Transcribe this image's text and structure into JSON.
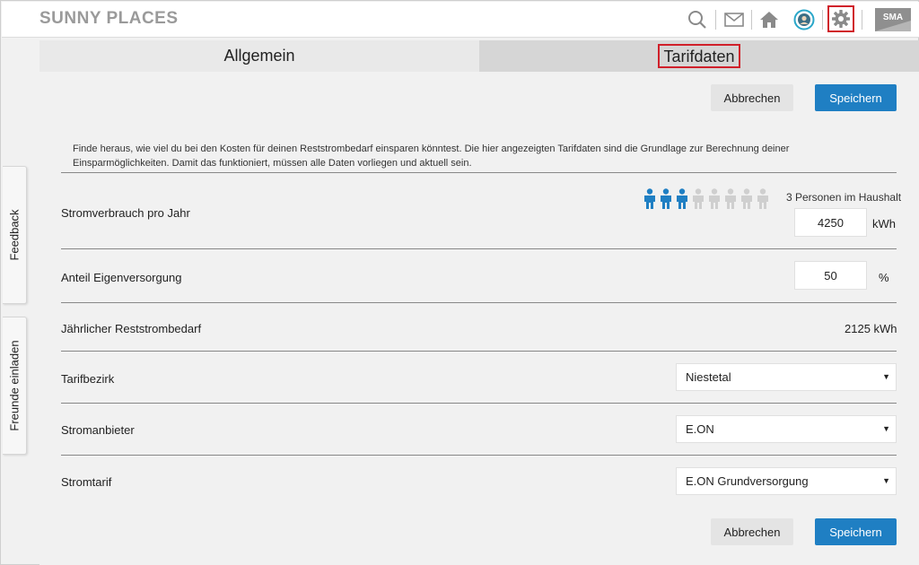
{
  "app": {
    "title": "SUNNY PLACES",
    "brand_logo": "SMA"
  },
  "header_icons": [
    "search-icon",
    "mail-icon",
    "home-icon",
    "profile-icon",
    "gear-icon"
  ],
  "side_tabs": {
    "feedback": "Feedback",
    "invite": "Freunde einladen"
  },
  "tabs": [
    {
      "label": "Allgemein",
      "active": false
    },
    {
      "label": "Tarifdaten",
      "active": true
    }
  ],
  "actions": {
    "cancel": "Abbrechen",
    "save": "Speichern"
  },
  "intro": "Finde heraus, wie viel du bei den Kosten für deinen Reststrombedarf einsparen könntest. Die hier angezeigten Tarifdaten sind die Grundlage zur Berechnung deiner Einsparmöglichkeiten. Damit das funktioniert, müssen alle Daten vorliegen und aktuell sein.",
  "consumption": {
    "label": "Stromverbrauch pro Jahr",
    "persons_selected": 3,
    "persons_total": 8,
    "persons_caption": "3 Personen im Haushalt",
    "value": "4250",
    "unit": "kWh"
  },
  "self_supply": {
    "label": "Anteil Eigenversorgung",
    "value": "50",
    "unit": "%"
  },
  "residual": {
    "label": "Jährlicher Reststrombedarf",
    "value": "2125 kWh"
  },
  "tariff_district": {
    "label": "Tarifbezirk",
    "selected": "Niestetal"
  },
  "provider": {
    "label": "Stromanbieter",
    "selected": "E.ON"
  },
  "tariff": {
    "label": "Stromtarif",
    "selected": "E.ON Grundversorgung"
  },
  "colors": {
    "accent": "#1f7fc3",
    "highlight": "#d0202a",
    "person_active": "#1f7fc3",
    "person_inactive": "#cfcfcf"
  }
}
